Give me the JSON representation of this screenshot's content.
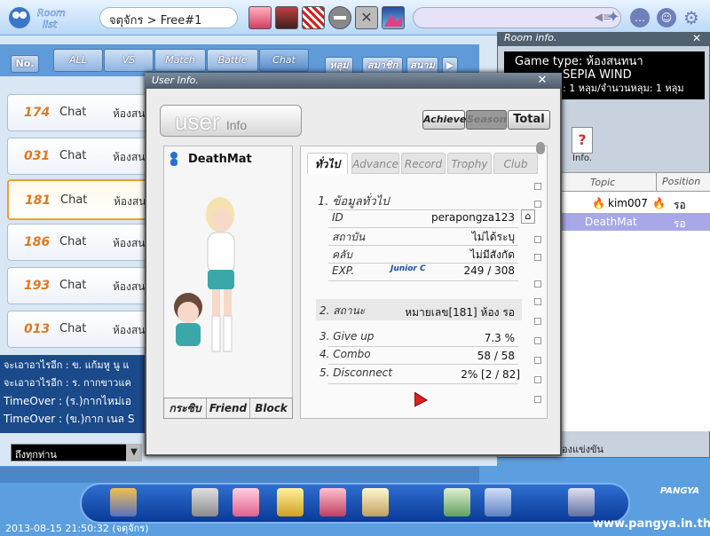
{
  "topbar": {
    "room_list_logo": "Room list",
    "channel": "จตุจักร > Free#1",
    "icons": [
      "avatar-1",
      "avatar-2",
      "avatar-3",
      "ball-icon",
      "close-x-icon",
      "mountain-icon"
    ],
    "right_icons": [
      "speaker-icon",
      "sparkle-icon",
      "chat-bubble-icon",
      "face-icon",
      "gear-icon"
    ]
  },
  "filters": {
    "no_label": "No.",
    "tabs": [
      "ALL",
      "VS",
      "Match",
      "Battle",
      "Chat"
    ],
    "right_tabs": [
      "หลุม",
      "สมาชิก",
      "สนาม"
    ]
  },
  "rooms": [
    {
      "num": "174",
      "mode": "Chat",
      "name": "ห้องสน"
    },
    {
      "num": "031",
      "mode": "Chat",
      "name": "ห้องสน"
    },
    {
      "num": "181",
      "mode": "Chat",
      "name": "ห้องสน",
      "selected": true
    },
    {
      "num": "186",
      "mode": "Chat",
      "name": "ห้องสน"
    },
    {
      "num": "193",
      "mode": "Chat",
      "name": "ห้องสน"
    },
    {
      "num": "013",
      "mode": "Chat",
      "name": "ห้องสน"
    }
  ],
  "chat_log": [
    "จะเอาอาไรอีก : ข. แก้มหู นู แ",
    "จะเอาอาไรอีก : ร. กากขาวแค",
    "TimeOver : (ร.)กากไหม่เอ",
    "TimeOver : (ข.)กาก เนล S"
  ],
  "chat_target": "ถึงทุกท่าน",
  "room_info": {
    "title": "Room info.",
    "game_type": "Game type: ห้องสนทนา",
    "course": "SEPIA WIND",
    "holes": ": 1 หลุม/จำนวนหลุม: 1 หลุม",
    "info_btn": "Info.",
    "col_topic": "Topic",
    "col_position": "Position",
    "players": [
      {
        "name": "kim007",
        "position": "รอ"
      },
      {
        "name": "DeathMat",
        "position": "รอ",
        "selected": true
      }
    ],
    "footer": "องแข่งขัน"
  },
  "user_info": {
    "title": "User Info.",
    "logo_big": "user",
    "logo_small": "Info",
    "view_tabs": [
      "Achieve.",
      "Season",
      "Total"
    ],
    "name": "DeathMat",
    "buttons": [
      "กระซิบ",
      "Friend",
      "Block"
    ],
    "info_tabs": [
      "ทั่วไป",
      "Advance",
      "Record",
      "Trophy",
      "Club"
    ],
    "section1": "1. ข้อมูลทั่วไป",
    "rows": [
      {
        "label": "ID",
        "value": "perapongza123"
      },
      {
        "label": "สถาบัน",
        "value": "ไม่ได้ระบุ"
      },
      {
        "label": "คลับ",
        "value": "ไม่มีสังกัด"
      },
      {
        "label": "EXP.",
        "value": "249 / 308",
        "rank": "Junior C"
      }
    ],
    "stats": [
      {
        "label": "2. สถานะ",
        "value": "หมายเลข[181] ห้อง รอ"
      },
      {
        "label": "3. Give up",
        "value": "7.3 %"
      },
      {
        "label": "4. Combo",
        "value": "58 / 58"
      },
      {
        "label": "5. Disconnect",
        "value": "2% [2 / 82]"
      }
    ]
  },
  "footer": {
    "timestamp": "2013-08-15 21:50:32 (จตุจักร)",
    "url": "www.pangya.in.th",
    "logo": "PANGYA",
    "bottom_icons": [
      "music-icon",
      "shop-icon",
      "gift-icon",
      "trophy-icon",
      "home-icon",
      "puzzle-icon",
      "house-arrow-icon",
      "cards-icon",
      "settings-icon"
    ]
  }
}
